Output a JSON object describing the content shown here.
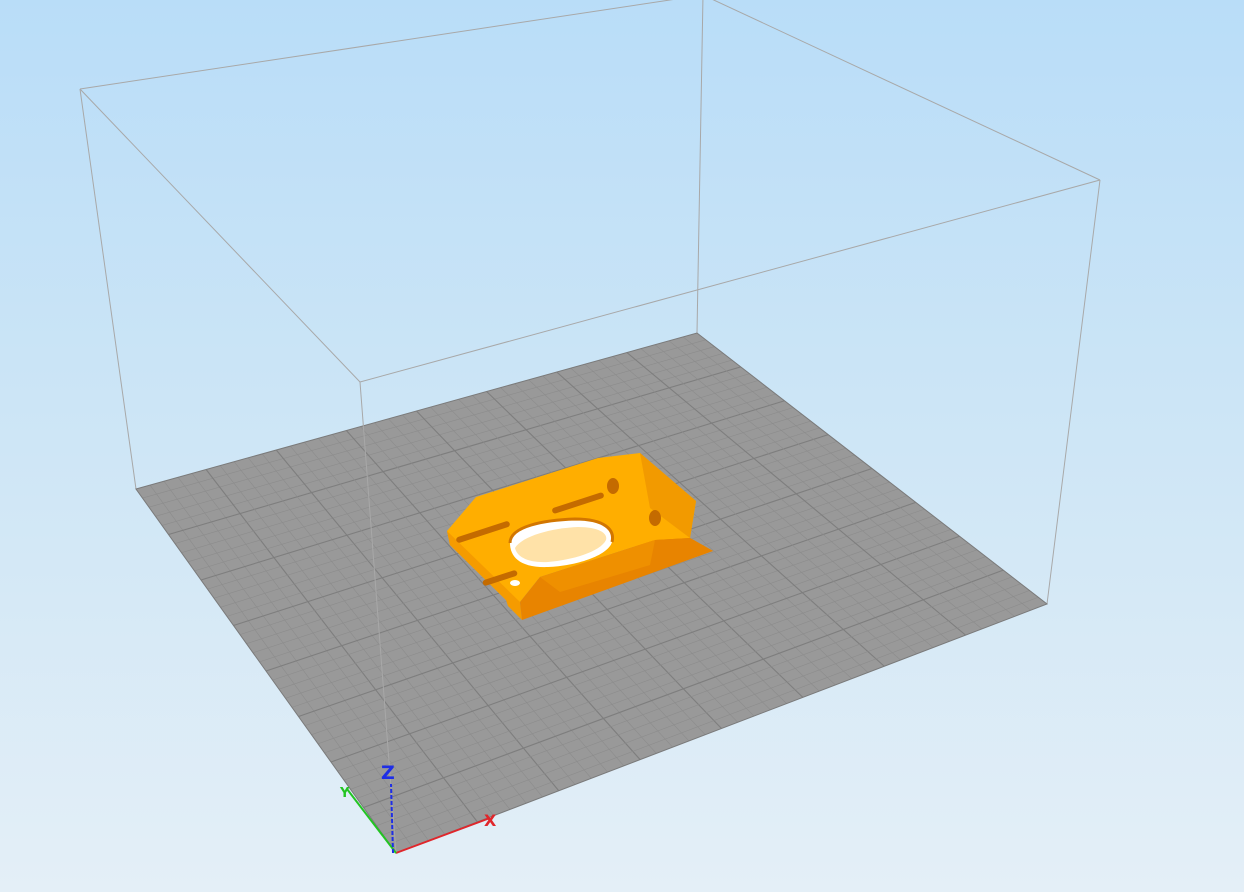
{
  "viewport": {
    "background_top": "#b9ddf8",
    "background_bottom": "#e4eff7"
  },
  "build_plate": {
    "color": "#999999",
    "grid_major_color": "#7e7e7e",
    "grid_minor_color": "#8c8c8c"
  },
  "build_volume": {
    "edge_color": "#a8a8a8"
  },
  "model": {
    "color_top": "#ffae00",
    "color_side": "#e88400",
    "color_dark": "#cf7400"
  },
  "axes": {
    "x_label": "X",
    "y_label": "Y",
    "z_label": "Z",
    "x_color": "#e0262b",
    "y_color": "#22c422",
    "z_color": "#1e2ee6"
  }
}
